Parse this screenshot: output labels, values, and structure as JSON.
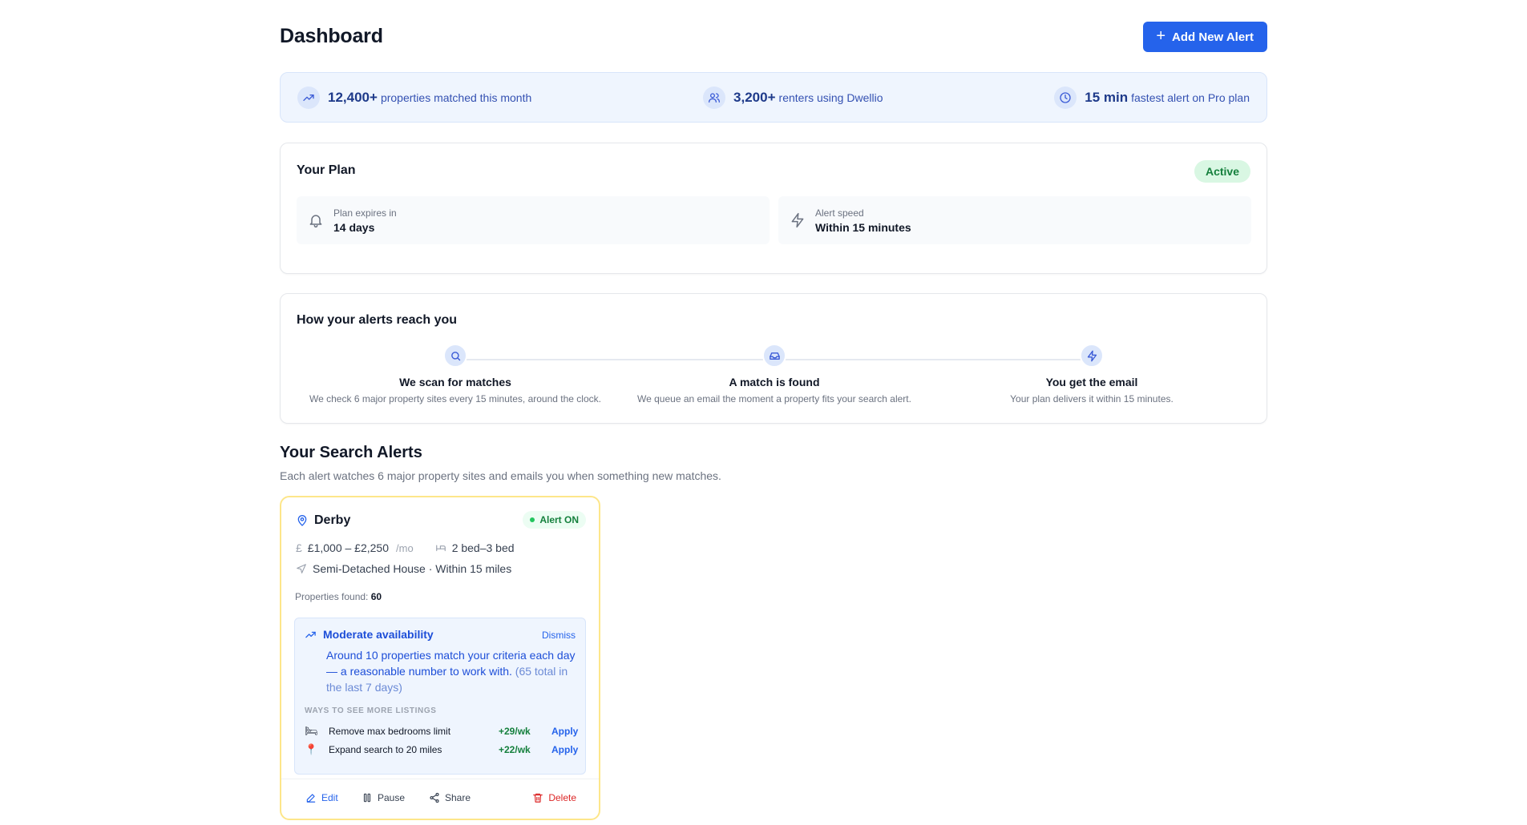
{
  "header": {
    "title": "Dashboard",
    "add_button": "Add New Alert"
  },
  "stats": [
    {
      "icon": "trending-up-icon",
      "value": "12,400+",
      "label": "properties matched this month"
    },
    {
      "icon": "users-icon",
      "value": "3,200+",
      "label": "renters using Dwellio"
    },
    {
      "icon": "clock-icon",
      "value": "15 min",
      "label": "fastest alert on Pro plan"
    }
  ],
  "plan": {
    "title": "Your Plan",
    "status": "Active",
    "expires_label": "Plan expires in",
    "expires_value": "14 days",
    "speed_label": "Alert speed",
    "speed_value": "Within 15 minutes"
  },
  "how": {
    "title": "How your alerts reach you",
    "steps": [
      {
        "icon": "search-icon",
        "title": "We scan for matches",
        "desc": "We check 6 major property sites every 15 minutes, around the clock."
      },
      {
        "icon": "inbox-icon",
        "title": "A match is found",
        "desc": "We queue an email the moment a property fits your search alert."
      },
      {
        "icon": "lightning-icon",
        "title": "You get the email",
        "desc": "Your plan delivers it within 15 minutes."
      }
    ]
  },
  "alerts_section": {
    "title": "Your Search Alerts",
    "subtitle": "Each alert watches 6 major property sites and emails you when something new matches."
  },
  "alert": {
    "location": "Derby",
    "status": "Alert ON",
    "price": "£1,000 – £2,250",
    "price_unit": "/mo",
    "beds": "2 bed–3 bed",
    "type": "Semi-Detached House · Within 15 miles",
    "found_label": "Properties found:",
    "found_value": "60",
    "availability": {
      "title": "Moderate availability",
      "dismiss": "Dismiss",
      "text": "Around 10 properties match your criteria each day — a reasonable number to work with.",
      "text_extra": "(65 total in the last 7 days)",
      "ways_title": "WAYS TO SEE MORE LISTINGS",
      "ways": [
        {
          "icon": "bed-icon",
          "label": "Remove max bedrooms limit",
          "gain": "+29/wk",
          "action": "Apply"
        },
        {
          "icon": "pin-icon",
          "label": "Expand search to 20 miles",
          "gain": "+22/wk",
          "action": "Apply"
        }
      ]
    },
    "actions": {
      "edit": "Edit",
      "pause": "Pause",
      "share": "Share",
      "delete": "Delete"
    }
  },
  "colors": {
    "accent": "#2563eb",
    "success": "#15803d",
    "danger": "#dc2626",
    "highlight_border": "#fde68a"
  }
}
